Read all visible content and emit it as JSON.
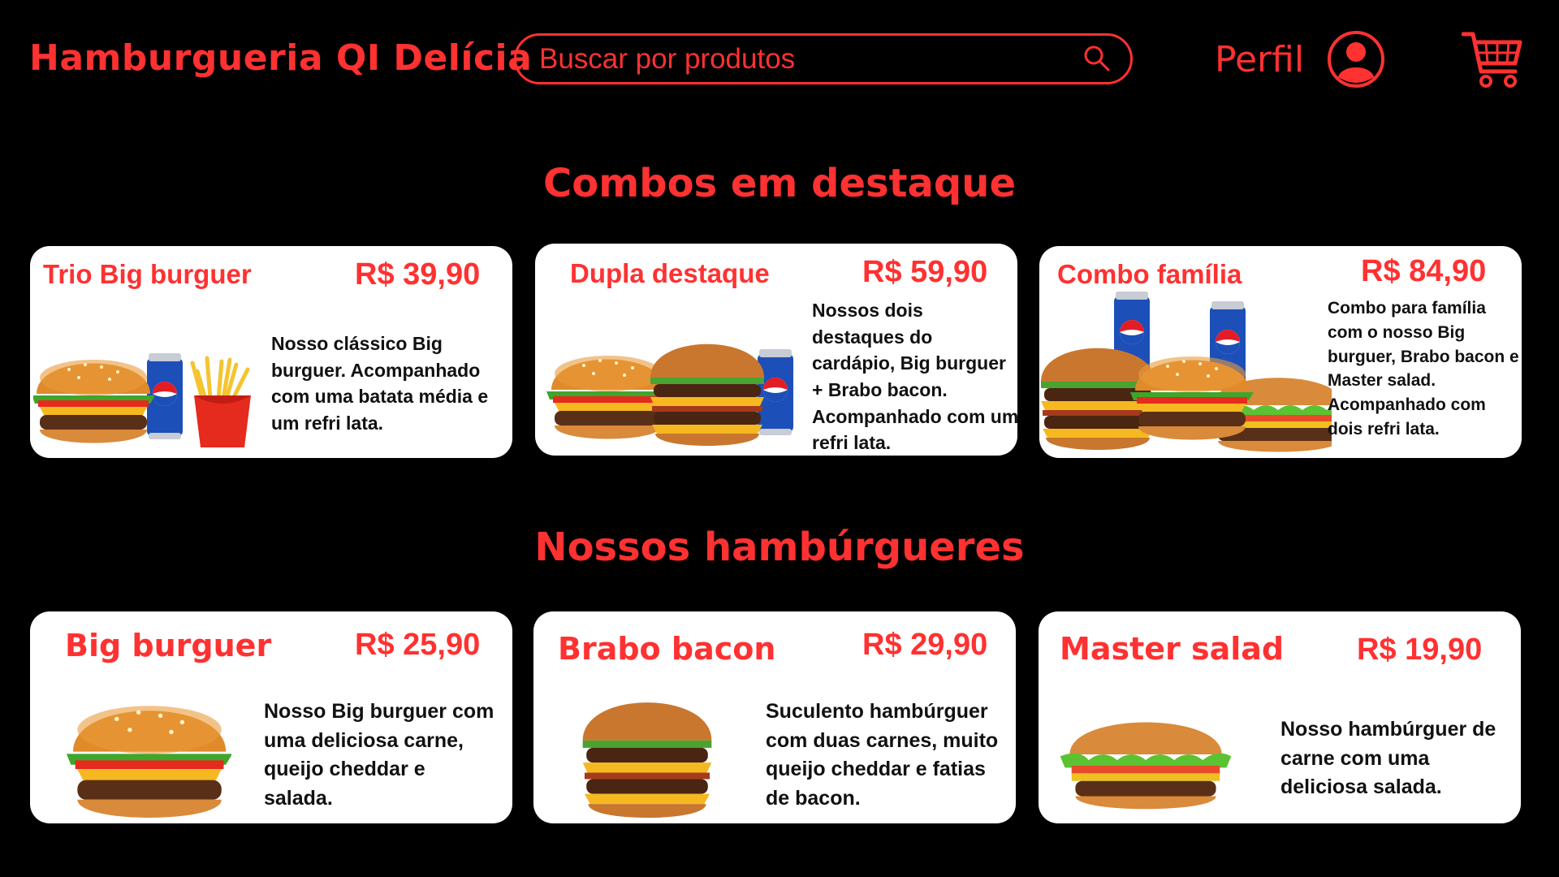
{
  "header": {
    "brand": "Hamburgueria QI Delícia",
    "search_placeholder": "Buscar por produtos",
    "profile_label": "Perfil"
  },
  "sections": {
    "combos_title": "Combos em destaque",
    "burgers_title": "Nossos hambúrgueres"
  },
  "combos": [
    {
      "title": "Trio Big burguer",
      "price": "R$ 39,90",
      "description": "Nosso clássico Big burguer. Acompanhado com uma batata média e um refri lata."
    },
    {
      "title": "Dupla destaque",
      "price": "R$ 59,90",
      "description": "Nossos dois destaques do cardápio, Big burguer + Brabo bacon. Acompanhado com um refri lata."
    },
    {
      "title": "Combo família",
      "price": "R$ 84,90",
      "description": "Combo para família com o nosso Big burguer, Brabo bacon e Master salad. Acompanhado com dois refri lata."
    }
  ],
  "burgers": [
    {
      "title": "Big burguer",
      "price": "R$ 25,90",
      "description": "Nosso Big burguer com uma deliciosa carne, queijo cheddar e salada."
    },
    {
      "title": "Brabo bacon",
      "price": "R$ 29,90",
      "description": "Suculento hambúrguer com duas carnes, muito queijo cheddar e fatias de bacon."
    },
    {
      "title": "Master salad",
      "price": "R$ 19,90",
      "description": "Nosso hambúrguer de carne com uma deliciosa salada."
    }
  ],
  "colors": {
    "accent": "#ff3131",
    "background": "#000000",
    "card": "#ffffff"
  },
  "icons": [
    "search-icon",
    "user-avatar-icon",
    "shopping-cart-icon",
    "burger-image",
    "soda-can-image",
    "fries-image"
  ]
}
